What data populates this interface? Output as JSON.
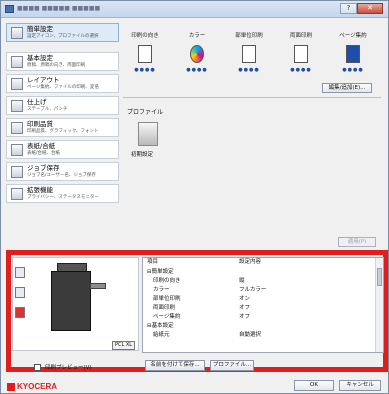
{
  "window": {
    "title": "■■■■ ■■■■■ ■■■■■",
    "buttons": {
      "help": "?",
      "minimize": "–",
      "close": "✕"
    }
  },
  "sidebar": {
    "items": [
      {
        "label": "簡単設定",
        "sub": "設定アイコン、プロファイルの選択",
        "icon": "quick-setup-icon"
      },
      {
        "label": "基本設定",
        "sub": "原稿、原稿の向き、両面印刷",
        "icon": "basic-settings-icon"
      },
      {
        "label": "レイアウト",
        "sub": "ページ集約、ファイルの印刷、変倍",
        "icon": "layout-icon"
      },
      {
        "label": "仕上げ",
        "sub": "ステープル、パンチ",
        "icon": "finishing-icon"
      },
      {
        "label": "印刷品質",
        "sub": "印刷品質、グラフィック、フォント",
        "icon": "print-quality-icon"
      },
      {
        "label": "表紙/合紙",
        "sub": "表紙/合紙、合紙",
        "icon": "cover-icon"
      },
      {
        "label": "ジョブ保存",
        "sub": "ジョブ名/ユーザー名、ジョブ保存",
        "icon": "job-storage-icon"
      },
      {
        "label": "拡張機能",
        "sub": "プライバシー、ステータスモニター",
        "icon": "advanced-icon"
      }
    ]
  },
  "features": {
    "columns": [
      {
        "label": "印刷の向き",
        "icon": "orientation-icon"
      },
      {
        "label": "カラー",
        "icon": "color-icon"
      },
      {
        "label": "部単位印刷",
        "icon": "collate-icon"
      },
      {
        "label": "両面印刷",
        "icon": "duplex-icon"
      },
      {
        "label": "ページ集約",
        "icon": "pages-per-sheet-icon"
      }
    ],
    "dots": "●●●●",
    "favorites_button": "編集/追加(E)..."
  },
  "profiles": {
    "label": "プロファイル",
    "items": [
      {
        "name": "初期設定"
      }
    ],
    "apply_button": "適用(P)"
  },
  "preview": {
    "pdl_badge": "PCL XL",
    "checkbox_label": "印刷プレビュー(V)"
  },
  "summary_table": {
    "headers": [
      "項目",
      "設定内容"
    ],
    "rows": [
      {
        "item": "⊟簡単設定",
        "value": ""
      },
      {
        "item": "印刷の向き",
        "value": "縦"
      },
      {
        "item": "カラー",
        "value": "フルカラー"
      },
      {
        "item": "部単位印刷",
        "value": "オン"
      },
      {
        "item": "両面印刷",
        "value": "オフ"
      },
      {
        "item": "ページ集約",
        "value": "オフ"
      },
      {
        "item": "⊟基本設定",
        "value": ""
      },
      {
        "item": "給紙元",
        "value": "自動選択"
      }
    ]
  },
  "footer": {
    "save_as_button": "名前を付けて保存...",
    "profile_button": "プロファイル...",
    "ok_button": "OK",
    "cancel_button": "キャンセル",
    "logo_text": "KYOCERA"
  },
  "colors": {
    "highlight": "#e11d1d",
    "accent": "#1f4ea8"
  }
}
